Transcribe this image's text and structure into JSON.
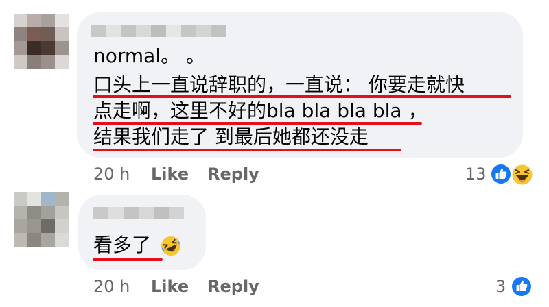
{
  "comments": [
    {
      "lines": [
        "normal。 。",
        "口头上一直说辞职的，一直说： 你要走就快",
        "点走啊，这里不好的bla bla bla bla ，",
        "结果我们走了 到最后她都还没走"
      ],
      "time": "20 h",
      "like_label": "Like",
      "reply_label": "Reply",
      "reaction_count": "13",
      "reactions": [
        "like-icon",
        "haha-icon"
      ]
    },
    {
      "lines": [
        "看多了"
      ],
      "emoji": "rofl-emoji",
      "time": "20 h",
      "like_label": "Like",
      "reply_label": "Reply",
      "reaction_count": "3",
      "reactions": [
        "like-icon"
      ]
    }
  ],
  "colors": {
    "bubble": "#f0f2f5",
    "underline": "#e3101b",
    "meta_text": "#65676b",
    "like_blue": "#1877f2",
    "haha_yellow": "#f7c531"
  }
}
